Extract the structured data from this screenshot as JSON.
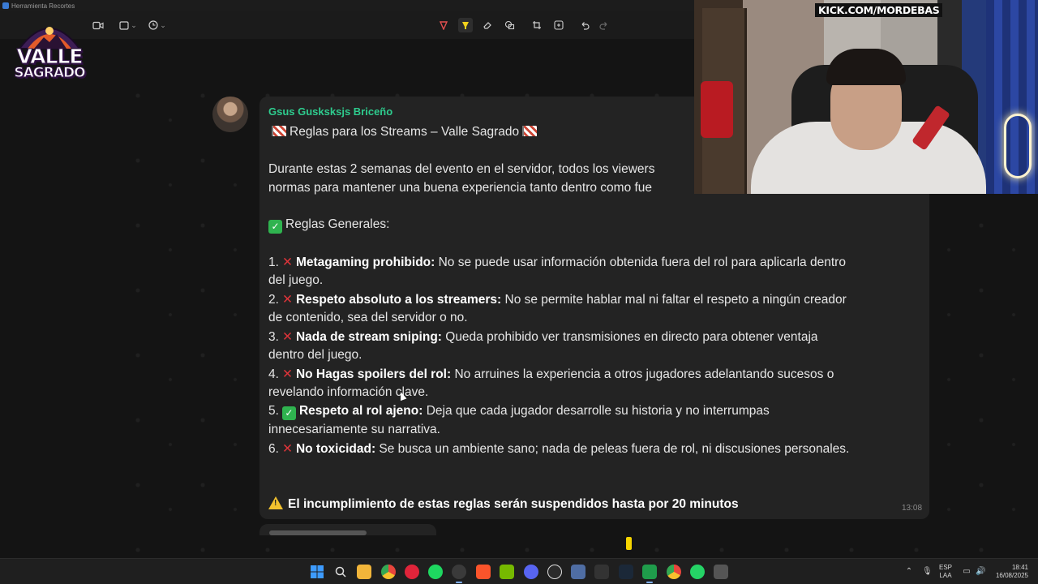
{
  "window": {
    "title": "Herramienta Recortes"
  },
  "logo": {
    "line1": "VALLE",
    "line2": "SAGRADO"
  },
  "stream_overlay": {
    "kick_text": "KICK.COM/MORDEBAS"
  },
  "message": {
    "sender": "Gsus Gusksksjs Briceño",
    "title": "Reglas para los Streams – Valle Sagrado",
    "intro_line1": "Durante estas 2 semanas del evento en el servidor, todos los viewers",
    "intro_line2": "normas para mantener una buena experiencia tanto dentro como fue",
    "section_heading": "Reglas Generales:",
    "rules": [
      {
        "num": "1.",
        "mark": "x",
        "bold": "Metagaming prohibido:",
        "text": " No se puede usar información obtenida fuera del rol para aplicarla dentro",
        "cont": "del juego."
      },
      {
        "num": "2.",
        "mark": "x",
        "bold": "Respeto absoluto a los streamers:",
        "text": " No se permite hablar mal ni faltar el respeto a ningún creador",
        "cont": "de contenido, sea del servidor o no."
      },
      {
        "num": "3.",
        "mark": "x",
        "bold": "Nada de stream sniping:",
        "text": " Queda prohibido ver transmisiones en directo para obtener ventaja",
        "cont": "dentro del juego."
      },
      {
        "num": "4.",
        "mark": "x",
        "bold": "No Hagas spoilers del rol:",
        "text": " No arruines la experiencia a otros jugadores adelantando sucesos o",
        "cont": "revelando información clave."
      },
      {
        "num": "5.",
        "mark": "check",
        "bold": "Respeto al rol ajeno:",
        "text": " Deja que cada jugador desarrolle su historia y no interrumpas",
        "cont": "innecesariamente su narrativa."
      },
      {
        "num": "6.",
        "mark": "x",
        "bold": "No toxicidad:",
        "text": " Se busca un ambiente sano; nada de peleas fuera de rol, ni discusiones personales.",
        "cont": ""
      }
    ],
    "warning": "El incumplimiento de estas reglas serán suspendidos hasta por 20 minutos",
    "time": "13:08"
  },
  "taskbar": {
    "lang_top": "ESP",
    "lang_bottom": "LAA",
    "clock_time": "18:41",
    "clock_date": "16/08/2025"
  },
  "colors": {
    "sender": "#2ecc8e",
    "bubble": "#232323",
    "background": "#141414"
  }
}
